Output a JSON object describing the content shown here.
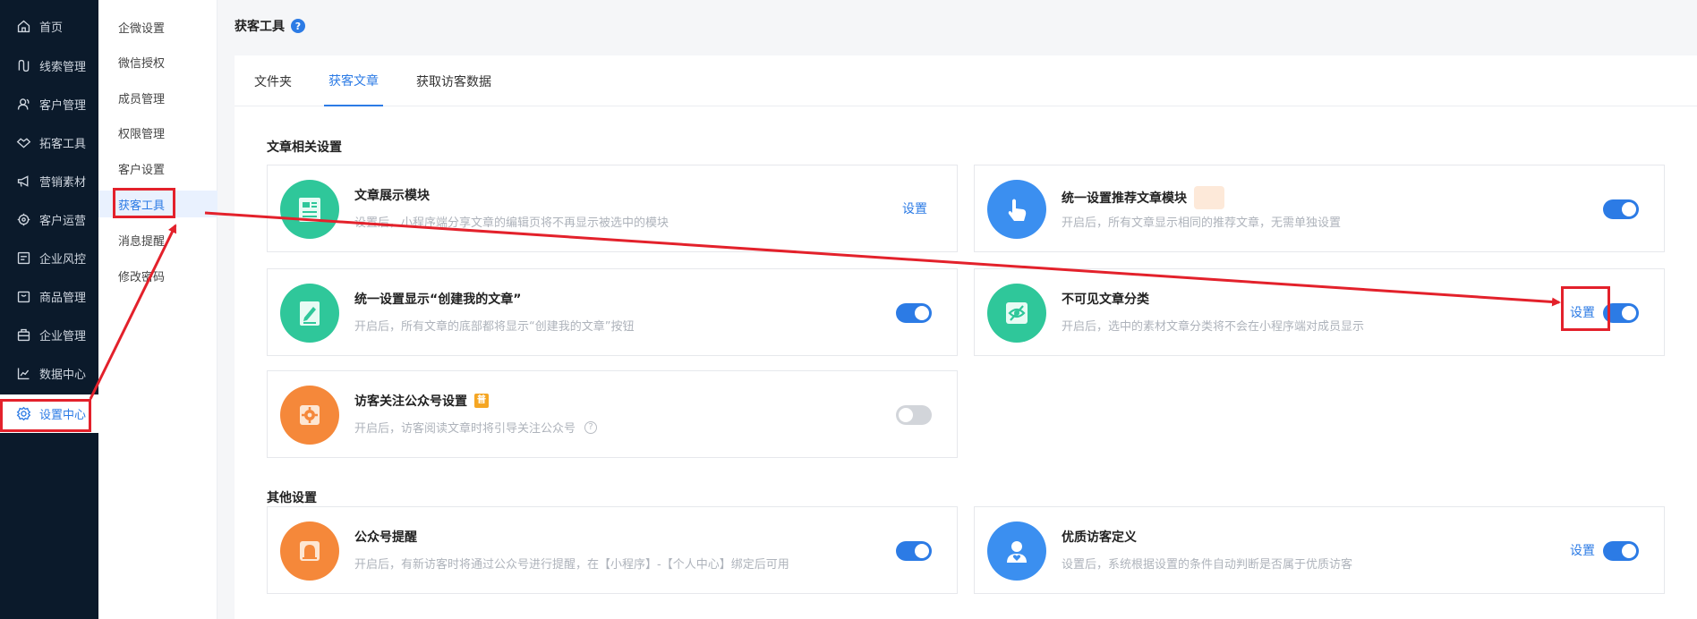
{
  "sidebar": {
    "items": [
      {
        "label": "首页",
        "icon": "home-icon"
      },
      {
        "label": "线索管理",
        "icon": "clue-icon"
      },
      {
        "label": "客户管理",
        "icon": "customers-icon"
      },
      {
        "label": "拓客工具",
        "icon": "handshake-icon"
      },
      {
        "label": "营销素材",
        "icon": "megaphone-icon"
      },
      {
        "label": "客户运营",
        "icon": "operations-icon"
      },
      {
        "label": "企业风控",
        "icon": "risk-control-icon"
      },
      {
        "label": "商品管理",
        "icon": "product-icon"
      },
      {
        "label": "企业管理",
        "icon": "enterprise-icon"
      },
      {
        "label": "数据中心",
        "icon": "chart-line-icon"
      },
      {
        "label": "设置中心",
        "icon": "gear-icon",
        "active": true
      }
    ]
  },
  "submenu": {
    "items": [
      "企微设置",
      "微信授权",
      "成员管理",
      "权限管理",
      "客户设置",
      "获客工具",
      "消息提醒",
      "修改密码"
    ],
    "active": "获客工具"
  },
  "page": {
    "title": "获客工具",
    "help": "?"
  },
  "tabs": [
    {
      "label": "文件夹"
    },
    {
      "label": "获客文章",
      "active": true
    },
    {
      "label": "获取访客数据"
    }
  ],
  "sections": {
    "article": "文章相关设置",
    "other": "其他设置"
  },
  "cards": {
    "display_module": {
      "title": "文章展示模块",
      "desc": "设置后，小程序端分享文章的编辑页将不再显示被选中的模块",
      "link": "设置"
    },
    "recommend_module": {
      "title": "统一设置推荐文章模块",
      "desc": "开启后，所有文章显示相同的推荐文章，无需单独设置",
      "toggle": true
    },
    "create_my_article": {
      "title": "统一设置显示“创建我的文章”",
      "desc": "开启后，所有文章的底部都将显示“创建我的文章”按钮",
      "toggle": true
    },
    "invisible_category": {
      "title": "不可见文章分类",
      "desc": "开启后，选中的素材文章分类将不会在小程序端对成员显示",
      "link": "设置",
      "toggle": true
    },
    "follow_official": {
      "title": "访客关注公众号设置",
      "tag": "普",
      "desc": "开启后，访客阅读文章时将引导关注公众号",
      "toggle": false
    },
    "official_remind": {
      "title": "公众号提醒",
      "desc": "开启后，有新访客时将通过公众号进行提醒，在【小程序】-【个人中心】绑定后可用",
      "toggle": true
    },
    "quality_visitor": {
      "title": "优质访客定义",
      "desc": "设置后，系统根据设置的条件自动判断是否属于优质访客",
      "link": "设置",
      "toggle": true
    }
  },
  "colors": {
    "accent": "#2c7be5",
    "sidebar_bg": "#0b1a2b",
    "annotation": "#e3212b"
  }
}
